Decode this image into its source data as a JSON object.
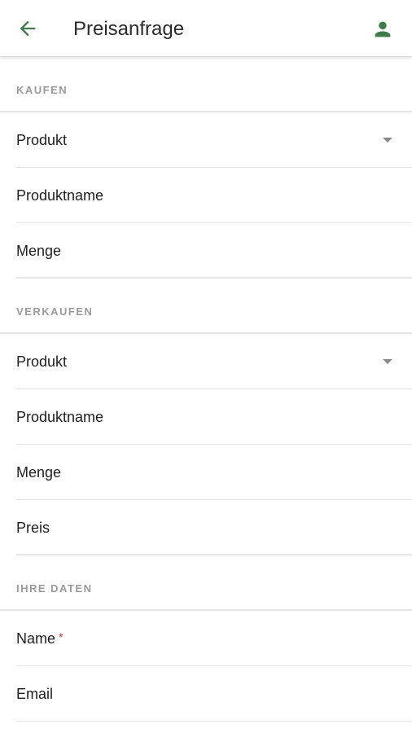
{
  "appbar": {
    "title": "Preisanfrage",
    "back_icon": "arrow-left-icon",
    "account_icon": "person-icon",
    "accent_color": "#3f7a4a"
  },
  "sections": [
    {
      "header": "KAUFEN",
      "fields": [
        {
          "label": "Produkt",
          "type": "select"
        },
        {
          "label": "Produktname",
          "type": "text"
        },
        {
          "label": "Menge",
          "type": "text"
        }
      ]
    },
    {
      "header": "VERKAUFEN",
      "fields": [
        {
          "label": "Produkt",
          "type": "select"
        },
        {
          "label": "Produktname",
          "type": "text"
        },
        {
          "label": "Menge",
          "type": "text"
        },
        {
          "label": "Preis",
          "type": "text"
        }
      ]
    },
    {
      "header": "IHRE DATEN",
      "fields": [
        {
          "label": "Name",
          "type": "text",
          "required_mark": "*"
        },
        {
          "label": "Email",
          "type": "text"
        }
      ]
    }
  ]
}
